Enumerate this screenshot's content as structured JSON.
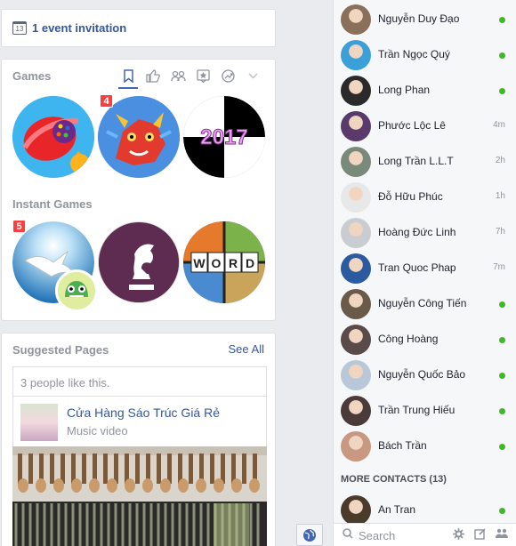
{
  "event": {
    "calendar_day": "13",
    "text": "1 event invitation"
  },
  "games": {
    "title": "Games",
    "tabs": [
      "bookmark-icon",
      "like-icon",
      "friends-icon",
      "star-icon",
      "trending-icon",
      "chevron-down-icon"
    ],
    "items": [
      {
        "name": "candy-crush",
        "badge": null
      },
      {
        "name": "dragon-city",
        "badge": "4"
      },
      {
        "name": "piano-tiles-2017",
        "badge": null,
        "label": "2017"
      }
    ],
    "instant_title": "Instant Games",
    "instant_items": [
      {
        "name": "dove-game",
        "badge": "5"
      },
      {
        "name": "chess",
        "badge": null
      },
      {
        "name": "word-game",
        "badge": null,
        "letters": [
          "W",
          "O",
          "R",
          "D"
        ]
      }
    ]
  },
  "suggested": {
    "title": "Suggested Pages",
    "see_all": "See All",
    "likes": "3 people like this.",
    "page_name": "Cửa Hàng Sáo Trúc Giá Rẻ",
    "page_sub": "Music video"
  },
  "chat": {
    "contacts": [
      {
        "name": "Nguyễn Duy Đạo",
        "status": "online",
        "color": "#8a6f5a"
      },
      {
        "name": "Trần Ngọc Quý",
        "status": "online",
        "color": "#3b9fd8"
      },
      {
        "name": "Long Phan",
        "status": "online",
        "color": "#2a2a2a"
      },
      {
        "name": "Phước Lộc Lê",
        "status": "4m",
        "color": "#5a3a6a"
      },
      {
        "name": "Long Trần L.L.T",
        "status": "2h",
        "color": "#7a8a7a"
      },
      {
        "name": "Đỗ Hữu Phúc",
        "status": "1h",
        "color": "#e8e8e8"
      },
      {
        "name": "Hoàng Đức Linh",
        "status": "7h",
        "color": "#c9ccd1"
      },
      {
        "name": "Tran Quoc Phap",
        "status": "7m",
        "color": "#2c5aa0"
      },
      {
        "name": "Nguyễn Công Tiến",
        "status": "online",
        "color": "#6a5a4a"
      },
      {
        "name": "Công Hoàng",
        "status": "online",
        "color": "#5a4a4a"
      },
      {
        "name": "Nguyễn Quốc Bảo",
        "status": "online",
        "color": "#b8c8d8"
      },
      {
        "name": "Trần Trung Hiếu",
        "status": "online",
        "color": "#4a3a3a"
      },
      {
        "name": "Bách Trần",
        "status": "online",
        "color": "#c89880"
      }
    ],
    "more_contacts": "MORE CONTACTS (13)",
    "more": [
      {
        "name": "An Tran",
        "status": "online",
        "color": "#4a3a2a"
      }
    ],
    "search_placeholder": "Search",
    "online_color": "#42b72a"
  }
}
